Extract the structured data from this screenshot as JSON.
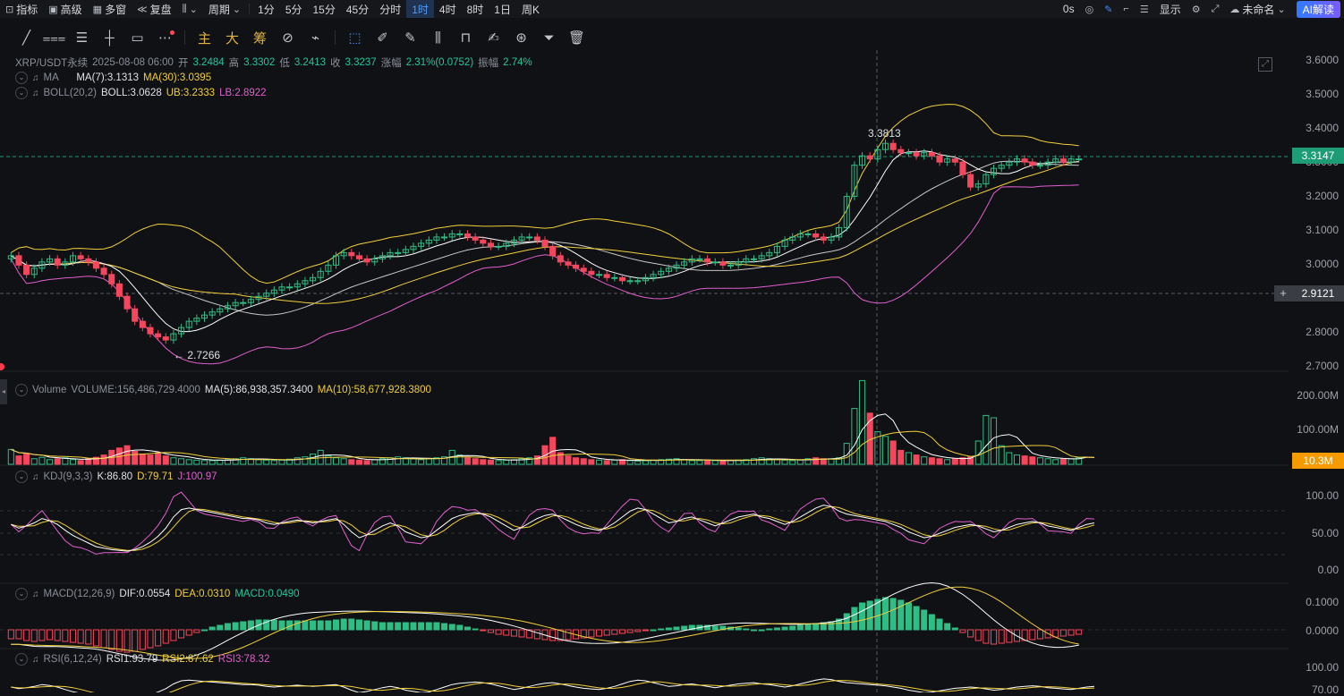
{
  "topbar": {
    "indicators": "指标",
    "advanced": "高级",
    "multiwindow": "多窗",
    "replay": "复盘",
    "period": "周期",
    "intervals": [
      "1分",
      "5分",
      "15分",
      "45分",
      "分时",
      "1时",
      "4时",
      "8时",
      "1日",
      "周K"
    ],
    "active_interval": "1时",
    "countdown": "0s",
    "display": "显示",
    "layout_name": "未命名",
    "ai_button": "AI解读"
  },
  "drawbar": {
    "gold_tools": [
      "主",
      "大",
      "筹"
    ]
  },
  "main": {
    "symbol": "XRP/USDT永续",
    "time": "2025-08-08 06:00",
    "open_label": "开",
    "open": "3.2484",
    "high_label": "高",
    "high": "3.3302",
    "low_label": "低",
    "low": "3.2413",
    "close_label": "收",
    "close": "3.3237",
    "change_label": "涨幅",
    "change": "2.31%(0.0752)",
    "amp_label": "振幅",
    "amp": "2.74%",
    "ma_name": "MA",
    "ma7": "MA(7):3.1313",
    "ma30": "MA(30):3.0395",
    "boll_name": "BOLL(20,2)",
    "boll": "BOLL:3.0628",
    "ub": "UB:3.2333",
    "lb": "LB:2.8922",
    "y_ticks": [
      "3.6000",
      "3.5000",
      "3.4000",
      "3.3000",
      "3.2000",
      "3.1000",
      "3.0000",
      "2.9000",
      "2.8000",
      "2.7000"
    ],
    "last_price": "3.3147",
    "cross_price": "2.9121",
    "high_mark": "3.3813",
    "low_mark": "← 2.7266"
  },
  "volume": {
    "name": "Volume",
    "value": "VOLUME:156,486,729.4000",
    "ma5": "MA(5):86,938,357.3400",
    "ma10": "MA(10):58,677,928.3800",
    "y_ticks": [
      "200.00M",
      "100.00M"
    ],
    "last": "10.3M"
  },
  "kdj": {
    "name": "KDJ(9,3,3)",
    "k": "K:86.80",
    "d": "D:79.71",
    "j": "J:100.97",
    "y_ticks": [
      "100.00",
      "50.00",
      "0.00"
    ]
  },
  "macd": {
    "name": "MACD(12,26,9)",
    "dif": "DIF:0.0554",
    "dea": "DEA:0.0310",
    "macd": "MACD:0.0490",
    "y_ticks": [
      "0.1000",
      "0.0000"
    ]
  },
  "rsi": {
    "name": "RSI(6,12,24)",
    "rsi1": "RSI1:93.79",
    "rsi2": "RSI2:87.62",
    "rsi3": "RSI3:78.32",
    "y_ticks": [
      "100.00",
      "70.00"
    ]
  },
  "colors": {
    "up": "#2ebd85",
    "down": "#f6465d",
    "ma7": "#ffffff",
    "ma30": "#f1cf3b",
    "boll_mid": "#c8c8c8",
    "boll_ub": "#f1cf3b",
    "boll_lb": "#e25fd0",
    "last_price_tag": "#1e9c76",
    "volume_tag": "#f59b00"
  },
  "chart_data": {
    "type": "candlestick",
    "price_range": [
      2.66,
      3.64
    ],
    "closes": [
      3.01,
      2.98,
      2.95,
      2.97,
      2.99,
      3.0,
      2.98,
      2.99,
      3.01,
      3.0,
      2.99,
      2.97,
      2.95,
      2.92,
      2.88,
      2.84,
      2.8,
      2.78,
      2.76,
      2.75,
      2.74,
      2.76,
      2.78,
      2.8,
      2.81,
      2.82,
      2.83,
      2.84,
      2.85,
      2.86,
      2.86,
      2.87,
      2.88,
      2.89,
      2.9,
      2.91,
      2.91,
      2.92,
      2.93,
      2.94,
      2.96,
      2.98,
      3.01,
      3.02,
      3.01,
      3.0,
      2.99,
      3.0,
      3.01,
      3.02,
      3.02,
      3.03,
      3.04,
      3.05,
      3.06,
      3.07,
      3.07,
      3.08,
      3.08,
      3.07,
      3.06,
      3.05,
      3.04,
      3.04,
      3.05,
      3.06,
      3.07,
      3.07,
      3.06,
      3.04,
      3.01,
      2.99,
      2.98,
      2.97,
      2.96,
      2.95,
      2.95,
      2.94,
      2.94,
      2.93,
      2.93,
      2.93,
      2.94,
      2.95,
      2.96,
      2.97,
      2.98,
      2.99,
      3.0,
      3.0,
      2.99,
      2.99,
      2.98,
      2.98,
      2.99,
      3.0,
      3.0,
      3.01,
      3.02,
      3.04,
      3.06,
      3.07,
      3.08,
      3.08,
      3.07,
      3.06,
      3.07,
      3.1,
      3.2,
      3.3,
      3.33,
      3.32,
      3.35,
      3.37,
      3.35,
      3.34,
      3.34,
      3.33,
      3.34,
      3.33,
      3.31,
      3.32,
      3.31,
      3.27,
      3.23,
      3.24,
      3.27,
      3.29,
      3.3,
      3.31,
      3.32,
      3.31,
      3.3,
      3.3,
      3.31,
      3.32,
      3.31,
      3.32,
      3.32
    ],
    "volumes": [
      32,
      18,
      22,
      12,
      15,
      10,
      12,
      14,
      10,
      8,
      12,
      15,
      20,
      30,
      35,
      40,
      28,
      22,
      20,
      25,
      18,
      14,
      12,
      10,
      9,
      8,
      8,
      9,
      10,
      12,
      14,
      12,
      10,
      9,
      8,
      9,
      11,
      14,
      16,
      22,
      30,
      18,
      14,
      12,
      10,
      9,
      8,
      10,
      12,
      14,
      16,
      14,
      12,
      10,
      12,
      14,
      16,
      30,
      20,
      14,
      12,
      10,
      9,
      8,
      9,
      10,
      12,
      14,
      18,
      40,
      58,
      25,
      18,
      14,
      12,
      10,
      9,
      8,
      9,
      10,
      8,
      7,
      8,
      9,
      10,
      11,
      12,
      10,
      8,
      8,
      9,
      8,
      7,
      8,
      9,
      10,
      12,
      14,
      12,
      10,
      9,
      8,
      9,
      12,
      14,
      12,
      12,
      14,
      45,
      120,
      180,
      110,
      70,
      60,
      50,
      30,
      25,
      20,
      16,
      14,
      12,
      10,
      12,
      14,
      16,
      50,
      105,
      100,
      40,
      25,
      20,
      18,
      16,
      14,
      12,
      10,
      11,
      12,
      14,
      28,
      10
    ],
    "kdj_k": [
      60,
      55,
      58,
      62,
      68,
      65,
      60,
      52,
      45,
      40,
      35,
      30,
      28,
      26,
      25,
      24,
      26,
      30,
      36,
      44,
      55,
      70,
      80,
      82,
      80,
      78,
      76,
      74,
      72,
      70,
      68,
      68,
      66,
      62,
      60,
      62,
      64,
      66,
      64,
      62,
      64,
      66,
      68,
      60,
      50,
      42,
      46,
      52,
      58,
      62,
      58,
      50,
      46,
      42,
      44,
      52,
      60,
      68,
      72,
      74,
      76,
      74,
      70,
      64,
      58,
      52,
      56,
      62,
      68,
      72,
      74,
      70,
      65,
      60,
      56,
      54,
      52,
      56,
      62,
      70,
      78,
      82,
      80,
      74,
      68,
      62,
      64,
      68,
      70,
      66,
      62,
      58,
      62,
      66,
      70,
      72,
      74,
      70,
      68,
      64,
      60,
      64,
      70,
      76,
      82,
      86,
      84,
      78,
      74,
      72,
      70,
      68,
      66,
      64,
      60,
      56,
      50,
      46,
      42,
      44,
      48,
      52,
      56,
      58,
      60,
      58,
      54,
      50,
      52,
      56,
      60,
      62,
      64,
      62,
      58,
      56,
      54,
      52,
      56,
      60,
      62
    ],
    "macd_hist": [
      -0.01,
      -0.01,
      -0.012,
      -0.013,
      -0.012,
      -0.011,
      -0.012,
      -0.013,
      -0.014,
      -0.015,
      -0.016,
      -0.018,
      -0.02,
      -0.022,
      -0.024,
      -0.025,
      -0.024,
      -0.022,
      -0.02,
      -0.018,
      -0.015,
      -0.012,
      -0.009,
      -0.006,
      -0.003,
      0,
      0.003,
      0.005,
      0.007,
      0.008,
      0.009,
      0.01,
      0.011,
      0.011,
      0.011,
      0.01,
      0.01,
      0.01,
      0.01,
      0.01,
      0.01,
      0.01,
      0.011,
      0.012,
      0.012,
      0.011,
      0.01,
      0.009,
      0.008,
      0.008,
      0.008,
      0.008,
      0.008,
      0.008,
      0.008,
      0.008,
      0.007,
      0.006,
      0.005,
      0.003,
      0.001,
      -0.001,
      -0.003,
      -0.005,
      -0.006,
      -0.007,
      -0.008,
      -0.009,
      -0.01,
      -0.011,
      -0.012,
      -0.012,
      -0.011,
      -0.01,
      -0.009,
      -0.008,
      -0.007,
      -0.006,
      -0.005,
      -0.004,
      -0.003,
      -0.002,
      -0.001,
      0,
      0.001,
      0.002,
      0.003,
      0.004,
      0.005,
      0.005,
      0.005,
      0.004,
      0.004,
      0.003,
      0.002,
      0.001,
      0,
      0,
      0.001,
      0.002,
      0.003,
      0.004,
      0.005,
      0.006,
      0.007,
      0.008,
      0.009,
      0.012,
      0.018,
      0.025,
      0.03,
      0.032,
      0.034,
      0.036,
      0.035,
      0.033,
      0.03,
      0.026,
      0.022,
      0.017,
      0.012,
      0.007,
      0.002,
      -0.003,
      -0.008,
      -0.012,
      -0.015,
      -0.016,
      -0.015,
      -0.014,
      -0.013,
      -0.012,
      -0.011,
      -0.01,
      -0.009,
      -0.008,
      -0.007,
      -0.006,
      -0.005
    ]
  }
}
